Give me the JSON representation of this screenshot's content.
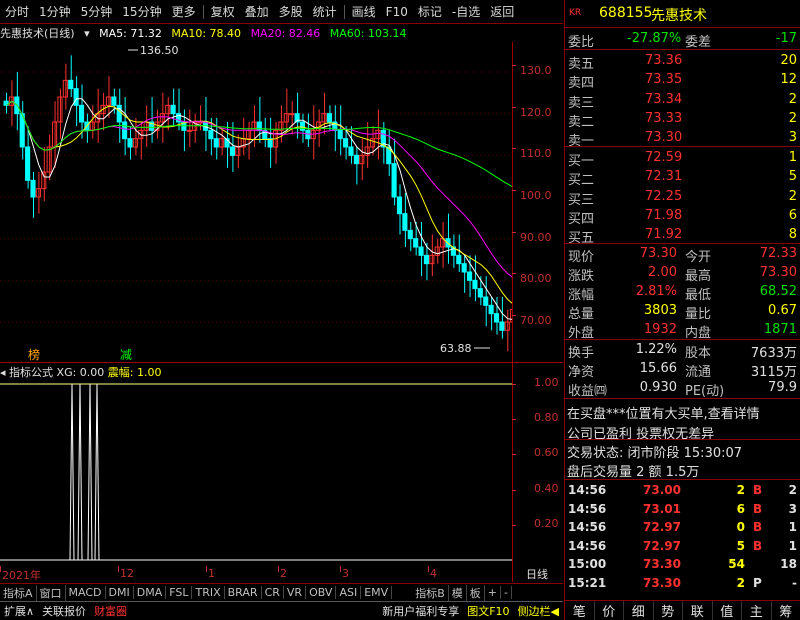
{
  "toolbar": {
    "items": [
      "分时",
      "1分钟",
      "5分钟",
      "15分钟",
      "更多",
      "复权",
      "叠加",
      "多股",
      "统计",
      "画线",
      "F10",
      "标记",
      "-自选",
      "返回"
    ]
  },
  "chart": {
    "stock_label": "先惠技术(日线)",
    "ma5": "MA5: 71.32",
    "ma10": "MA10: 78.40",
    "ma20": "MA20: 82.46",
    "ma60": "MA60: 103.14",
    "high_label": "136.50",
    "low_label": "63.88",
    "marker_1": "榜",
    "marker_2": "减",
    "colors": {
      "ma5": "#ffffff",
      "ma10": "#ffff00",
      "ma20": "#ff00ff",
      "ma60": "#00ff00",
      "up": "#ff3030",
      "down": "#00ffff"
    }
  },
  "price_axis": [
    "130.0",
    "120.0",
    "110.0",
    "100.0",
    "90.00",
    "80.00",
    "70.00"
  ],
  "indicator": {
    "title": "指标公式",
    "xg": "XG: 0.00",
    "zhenfu": "震幅: 1.00",
    "axis": [
      "1.00",
      "0.80",
      "0.60",
      "0.40",
      "0.20"
    ]
  },
  "date_axis": {
    "labels": [
      "2021年",
      "12",
      "1",
      "2",
      "3",
      "4"
    ],
    "right_label": "日线"
  },
  "bottom_tabs": [
    "指标A",
    "窗口",
    "MACD",
    "DMI",
    "DMA",
    "FSL",
    "TRIX",
    "BRAR",
    "CR",
    "VR",
    "OBV",
    "ASI",
    "EMV",
    "指标B",
    "模",
    "板",
    "+",
    "-"
  ],
  "status_bar": [
    "扩展∧",
    "关联报价",
    "财富圈",
    "新用户福利专享",
    "图文F10",
    "侧边栏◀"
  ],
  "quote": {
    "code": "688155",
    "name": "先惠技术",
    "weibi_label": "委比",
    "weibi": "-27.87%",
    "weicha_label": "委差",
    "weicha": "-17",
    "sell": [
      {
        "label": "卖五",
        "price": "73.36",
        "vol": "20"
      },
      {
        "label": "卖四",
        "price": "73.35",
        "vol": "12"
      },
      {
        "label": "卖三",
        "price": "73.34",
        "vol": "2"
      },
      {
        "label": "卖二",
        "price": "73.33",
        "vol": "2"
      },
      {
        "label": "卖一",
        "price": "73.30",
        "vol": "3"
      }
    ],
    "buy": [
      {
        "label": "买一",
        "price": "72.59",
        "vol": "1"
      },
      {
        "label": "买二",
        "price": "72.31",
        "vol": "5"
      },
      {
        "label": "买三",
        "price": "72.25",
        "vol": "2"
      },
      {
        "label": "买四",
        "price": "71.98",
        "vol": "6"
      },
      {
        "label": "买五",
        "price": "71.92",
        "vol": "8"
      }
    ],
    "stats": [
      {
        "l1": "现价",
        "v1": "73.30",
        "c1": "red",
        "l2": "今开",
        "v2": "72.33",
        "c2": "red"
      },
      {
        "l1": "涨跌",
        "v1": "2.00",
        "c1": "red",
        "l2": "最高",
        "v2": "73.30",
        "c2": "red"
      },
      {
        "l1": "涨幅",
        "v1": "2.81%",
        "c1": "red",
        "l2": "最低",
        "v2": "68.52",
        "c2": "green"
      },
      {
        "l1": "总量",
        "v1": "3803",
        "c1": "yellow",
        "l2": "量比",
        "v2": "0.67",
        "c2": "yellow"
      },
      {
        "l1": "外盘",
        "v1": "1932",
        "c1": "red",
        "l2": "内盘",
        "v2": "1871",
        "c2": "green"
      }
    ],
    "stats2": [
      {
        "l1": "换手",
        "v1": "1.22%",
        "l2": "股本",
        "v2": "7633万"
      },
      {
        "l1": "净资",
        "v1": "15.66",
        "l2": "流通",
        "v2": "3115万"
      },
      {
        "l1": "收益㈣",
        "v1": "0.930",
        "l2": "PE(动)",
        "v2": "79.9"
      }
    ],
    "notice1": "在买盘***位置有大买单,查看详情",
    "notice2": "公司已盈利 投票权无差异",
    "trade_status": "交易状态: 闭市阶段 15:30:07",
    "after_hours": "盘后交易量 2 额 1.5万",
    "ticks": [
      {
        "t": "14:56",
        "p": "73.00",
        "v": "2",
        "f": "B",
        "n": "2"
      },
      {
        "t": "14:56",
        "p": "73.01",
        "v": "6",
        "f": "B",
        "n": "3"
      },
      {
        "t": "14:56",
        "p": "72.97",
        "v": "0",
        "f": "B",
        "n": "1"
      },
      {
        "t": "14:56",
        "p": "72.97",
        "v": "5",
        "f": "B",
        "n": "1"
      },
      {
        "t": "15:00",
        "p": "73.30",
        "v": "54",
        "f": "",
        "n": "18"
      },
      {
        "t": "15:21",
        "p": "73.30",
        "v": "2",
        "f": "P",
        "n": "-"
      }
    ],
    "bottom_tabs": [
      "笔",
      "价",
      "细",
      "势",
      "联",
      "值",
      "主",
      "筹"
    ]
  }
}
